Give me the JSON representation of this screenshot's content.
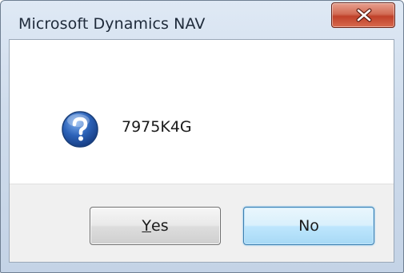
{
  "window": {
    "title": "Microsoft Dynamics NAV"
  },
  "message": {
    "icon": "question-icon",
    "text": "7975K4G"
  },
  "buttons": {
    "yes": {
      "mnemonic": "Y",
      "rest": "es"
    },
    "no": {
      "label": "No"
    }
  },
  "colors": {
    "title_bar": "#d3dfee",
    "close_button": "#c74a32",
    "icon_blue": "#2c62b8",
    "button_bar": "#f0f0f0",
    "default_button_border": "#3c7fb1"
  }
}
